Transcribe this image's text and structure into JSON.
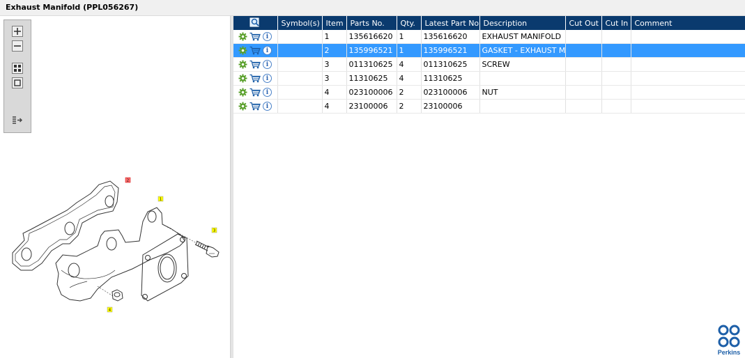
{
  "window": {
    "title": "Exhaust Manifold (PPL056267)"
  },
  "zoom_toolbar": {
    "buttons": [
      "zoom-in-icon",
      "zoom-out-icon",
      "fit-all-icon",
      "actual-size-icon",
      "export-list-icon"
    ]
  },
  "diagram": {
    "callouts": [
      "2",
      "1",
      "3",
      "4"
    ]
  },
  "table": {
    "columns": [
      "",
      "Symbol(s)",
      "Item",
      "Parts No.",
      "Qty.",
      "Latest Part No.",
      "Description",
      "Cut Out",
      "Cut In",
      "Comment"
    ],
    "rows": [
      {
        "item": "1",
        "parts_no": "135616620",
        "qty": "1",
        "latest": "135616620",
        "description": "EXHAUST MANIFOLD",
        "cut_out": "",
        "cut_in": "",
        "comment": "",
        "selected": false
      },
      {
        "item": "2",
        "parts_no": "135996521",
        "qty": "1",
        "latest": "135996521",
        "description": "GASKET - EXHAUST MAN",
        "cut_out": "",
        "cut_in": "",
        "comment": "",
        "selected": true
      },
      {
        "item": "3",
        "parts_no": "011310625",
        "qty": "4",
        "latest": "011310625",
        "description": "SCREW",
        "cut_out": "",
        "cut_in": "",
        "comment": "",
        "selected": false
      },
      {
        "item": "3",
        "parts_no": "11310625",
        "qty": "4",
        "latest": "11310625",
        "description": "",
        "cut_out": "",
        "cut_in": "",
        "comment": "",
        "selected": false
      },
      {
        "item": "4",
        "parts_no": "023100006",
        "qty": "2",
        "latest": "023100006",
        "description": "NUT",
        "cut_out": "",
        "cut_in": "",
        "comment": "",
        "selected": false
      },
      {
        "item": "4",
        "parts_no": "23100006",
        "qty": "2",
        "latest": "23100006",
        "description": "",
        "cut_out": "",
        "cut_in": "",
        "comment": "",
        "selected": false
      }
    ]
  },
  "brand": {
    "name": "Perkins"
  },
  "colors": {
    "header_bg": "#0a3a6e",
    "selection": "#3399ff",
    "brand_blue": "#1d5fa8"
  }
}
